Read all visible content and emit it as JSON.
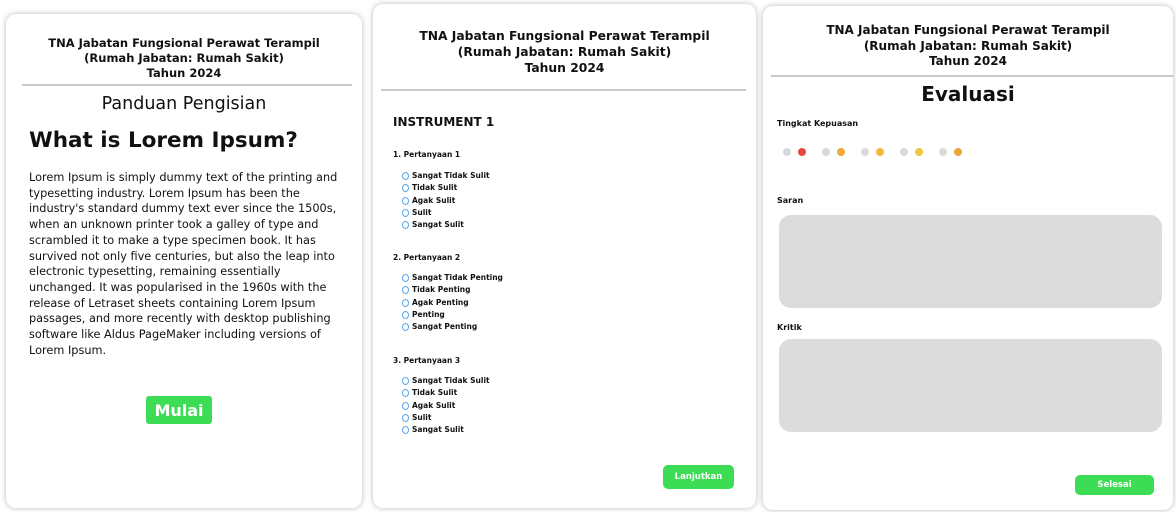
{
  "header": {
    "line1": "TNA Jabatan Fungsional Perawat Terampil",
    "line2": "(Rumah Jabatan: Rumah Sakit)",
    "line3": "Tahun 2024"
  },
  "screen1": {
    "guide_title": "Panduan Pengisian",
    "heading": "What is Lorem Ipsum?",
    "body": "Lorem Ipsum is simply dummy text of the printing and typesetting industry. Lorem Ipsum has been the industry's standard dummy text ever since the 1500s, when an unknown printer took a galley of type and scrambled it to make a type specimen book. It has survived not only five centuries, but also the leap into electronic typesetting, remaining essentially unchanged. It was popularised in the 1960s with the release of Letraset sheets containing Lorem Ipsum passages, and more recently with desktop publishing software like Aldus PageMaker including versions of Lorem Ipsum.",
    "start_button": "Mulai"
  },
  "screen2": {
    "instrument_title": "INSTRUMENT 1",
    "questions": [
      {
        "label": "1. Pertanyaan 1",
        "options": [
          "Sangat Tidak Sulit",
          "Tidak Sulit",
          "Agak Sulit",
          "Sulit",
          "Sangat Sulit"
        ]
      },
      {
        "label": "2. Pertanyaan 2",
        "options": [
          "Sangat Tidak Penting",
          "Tidak Penting",
          "Agak Penting",
          "Penting",
          "Sangat Penting"
        ]
      },
      {
        "label": "3. Pertanyaan 3",
        "options": [
          "Sangat Tidak Sulit",
          "Tidak Sulit",
          "Agak Sulit",
          "Sulit",
          "Sangat Sulit"
        ]
      }
    ],
    "next_button": "Lanjutkan"
  },
  "screen3": {
    "title": "Evaluasi",
    "satisfaction_label": "Tingkat Kepuasan",
    "rating_faces": [
      "very-unhappy-face-icon",
      "unhappy-face-icon",
      "neutral-face-icon",
      "happy-face-icon",
      "very-happy-face-icon"
    ],
    "face_colors": [
      "#e8453c",
      "#f2a93b",
      "#f6b73c",
      "#f4c542",
      "#f0a53a"
    ],
    "suggestion_label": "Saran",
    "critique_label": "Kritik",
    "finish_button": "Selesai"
  },
  "colors": {
    "accent_green": "#3ddc55",
    "field_gray": "#dcdcdc",
    "radio_blue": "#5aa7ea"
  }
}
